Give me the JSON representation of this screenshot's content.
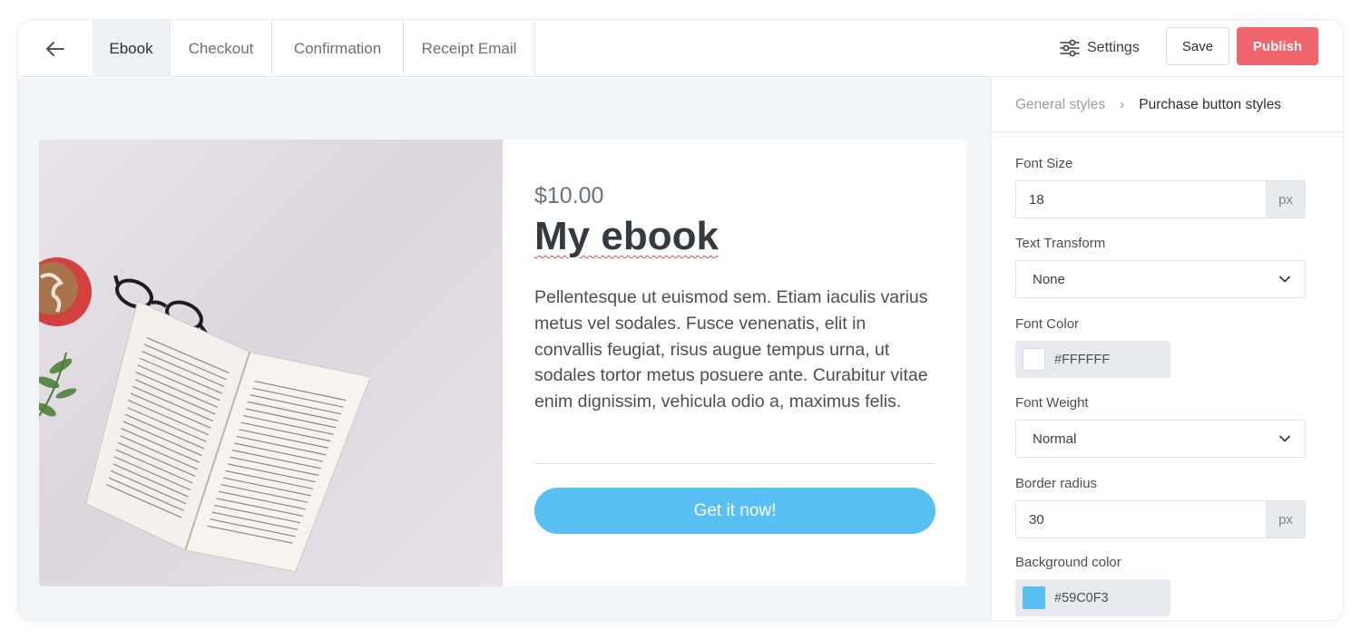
{
  "tabs": [
    {
      "label": "Ebook",
      "active": true
    },
    {
      "label": "Checkout",
      "active": false
    },
    {
      "label": "Confirmation",
      "active": false
    },
    {
      "label": "Receipt Email",
      "active": false
    }
  ],
  "toolbar": {
    "settings_label": "Settings",
    "save_label": "Save",
    "publish_label": "Publish"
  },
  "product": {
    "price": "$10.00",
    "title": "My ebook",
    "description": "Pellentesque ut euismod sem. Etiam iaculis varius metus vel sodales. Fusce venenatis, elit in convallis feugiat, risus augue tempus urna, ut sodales tortor metus posuere ante. Curabitur vitae enim dignissim, vehicula odio a, maximus felis.",
    "button_label": "Get it now!"
  },
  "panel": {
    "breadcrumb": {
      "parent": "General styles",
      "separator": "›",
      "current": "Purchase button styles"
    },
    "font_size": {
      "label": "Font Size",
      "value": "18",
      "unit": "px"
    },
    "text_transform": {
      "label": "Text Transform",
      "value": "None"
    },
    "font_color": {
      "label": "Font Color",
      "value": "#FFFFFF"
    },
    "font_weight": {
      "label": "Font Weight",
      "value": "Normal"
    },
    "border_radius": {
      "label": "Border radius",
      "value": "30",
      "unit": "px"
    },
    "background_color": {
      "label": "Background color",
      "value": "#59C0F3"
    }
  },
  "colors": {
    "publish": "#f0646b",
    "button": "#59c0f3",
    "canvas": "#f2f5f8"
  }
}
